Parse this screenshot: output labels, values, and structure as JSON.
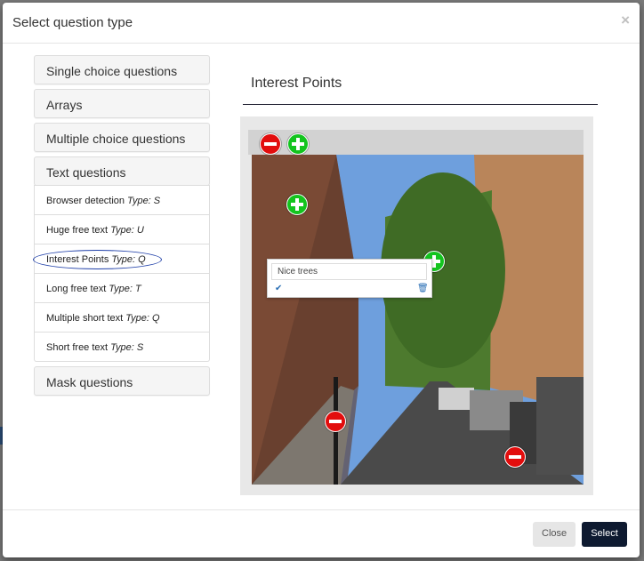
{
  "modal": {
    "title": "Select question type",
    "close_symbol": "×"
  },
  "groups": [
    {
      "label": "Single choice questions"
    },
    {
      "label": "Arrays"
    },
    {
      "label": "Multiple choice questions"
    },
    {
      "label": "Text questions",
      "expanded": true,
      "items": [
        {
          "label": "Browser detection",
          "type": "Type: S"
        },
        {
          "label": "Huge free text",
          "type": "Type: U"
        },
        {
          "label": "Interest Points",
          "type": "Type: Q",
          "selected": true
        },
        {
          "label": "Long free text",
          "type": "Type: T"
        },
        {
          "label": "Multiple short text",
          "type": "Type: Q"
        },
        {
          "label": "Short free text",
          "type": "Type: S"
        }
      ]
    },
    {
      "label": "Mask questions"
    }
  ],
  "preview": {
    "title": "Interest Points",
    "toolbar": {
      "remove_icon": "minus-circle-icon",
      "add_icon": "plus-circle-icon"
    },
    "annotation": {
      "value": "Nice trees",
      "confirm_icon": "check-icon",
      "delete_icon": "trash-icon"
    }
  },
  "footer": {
    "close_label": "Close",
    "select_label": "Select"
  },
  "colors": {
    "select_button": "#0e1a30",
    "add_marker": "#13c41e",
    "remove_marker": "#e20d0d",
    "selection_ring": "#1f3fa8"
  }
}
